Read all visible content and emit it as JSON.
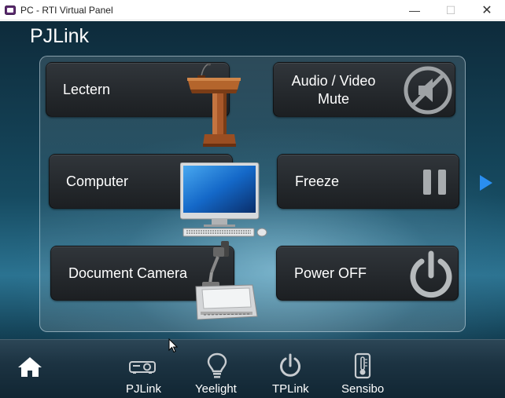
{
  "window": {
    "title": "PC - RTI Virtual Panel",
    "minimize_glyph": "—",
    "maximize_glyph": "☐",
    "close_glyph": "✕"
  },
  "page": {
    "title": "PJLink"
  },
  "buttons": {
    "lectern": "Lectern",
    "av_mute_line1": "Audio / Video",
    "av_mute_line2": "Mute",
    "computer": "Computer",
    "freeze": "Freeze",
    "document_camera": "Document Camera",
    "power_off": "Power OFF"
  },
  "bottom_nav": {
    "pjlink": "PJLink",
    "yeelight": "Yeelight",
    "tplink": "TPLink",
    "sensibo": "Sensibo"
  },
  "icons": {
    "app": "rti-app-icon",
    "lectern": "lectern-icon",
    "av_mute": "speaker-muted-icon",
    "computer": "desktop-computer-icon",
    "freeze": "pause-icon",
    "document_camera": "document-camera-icon",
    "power": "power-icon",
    "next": "play-arrow-icon",
    "home": "home-icon",
    "projector": "projector-icon",
    "bulb": "light-bulb-icon",
    "tplink": "power-icon",
    "thermometer": "thermometer-icon"
  },
  "colors": {
    "accent_arrow": "#2a8ef0",
    "button_bg": "#2a2e32",
    "bottom_bar": "#1c3342"
  }
}
